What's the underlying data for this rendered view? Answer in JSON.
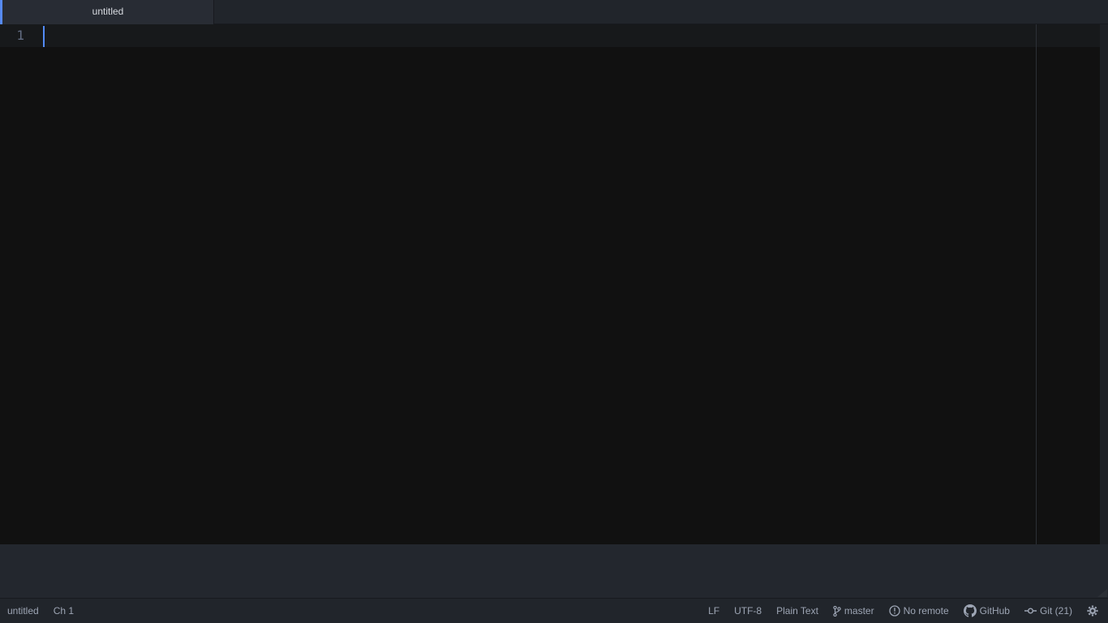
{
  "tabs": [
    {
      "label": "untitled",
      "active": true
    }
  ],
  "editor": {
    "line_numbers": [
      "1"
    ],
    "content": ""
  },
  "status_bar": {
    "file_name": "untitled",
    "cursor_position": "Ch 1",
    "line_ending": "LF",
    "encoding": "UTF-8",
    "grammar": "Plain Text",
    "branch": "master",
    "remote": "No remote",
    "github": "GitHub",
    "git": "Git (21)"
  },
  "icons": {
    "branch": "git-branch-icon",
    "remote": "alert-circle-icon",
    "github": "github-icon",
    "git": "git-commit-icon",
    "settings": "gear-icon"
  },
  "colors": {
    "accent": "#568af2",
    "caret": "#528bff",
    "editor_bg": "#111111",
    "chrome_bg": "#21252b"
  }
}
